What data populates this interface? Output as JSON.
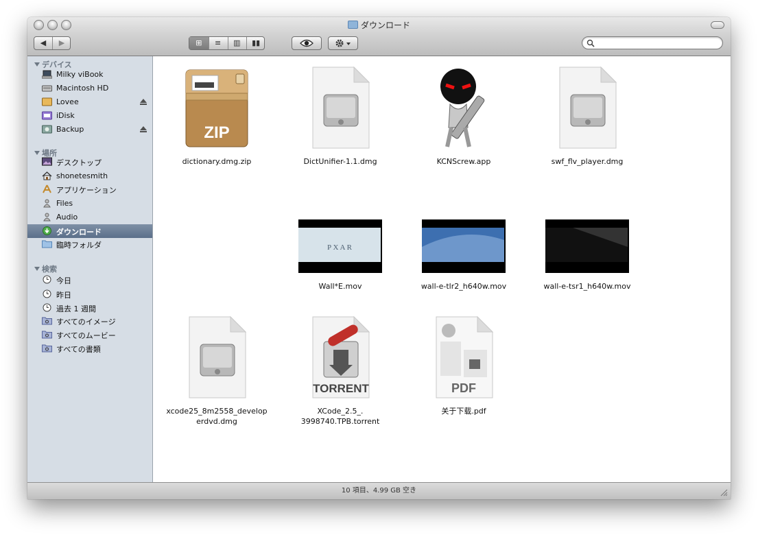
{
  "window": {
    "title": "ダウンロード"
  },
  "toolbar": {
    "back_label": "◀",
    "forward_label": "▶",
    "view_modes": [
      {
        "name": "icon-view",
        "glyph": "⊞",
        "selected": true
      },
      {
        "name": "list-view",
        "glyph": "≡",
        "selected": false
      },
      {
        "name": "column-view",
        "glyph": "▥",
        "selected": false
      },
      {
        "name": "coverflow-view",
        "glyph": "▮▮",
        "selected": false
      }
    ],
    "quicklook_glyph": "◉",
    "action_glyph": "✲▾",
    "search": {
      "placeholder": "",
      "icon": "magnifier-icon"
    }
  },
  "sidebar": {
    "sections": [
      {
        "heading": "デバイス",
        "items": [
          {
            "label": "Milky viBook",
            "icon": "laptop-icon",
            "eject": false
          },
          {
            "label": "Macintosh HD",
            "icon": "harddisk-icon",
            "eject": false
          },
          {
            "label": "Lovee",
            "icon": "external-disk-icon",
            "eject": true
          },
          {
            "label": "iDisk",
            "icon": "idisk-icon",
            "eject": false
          },
          {
            "label": "Backup",
            "icon": "backup-disk-icon",
            "eject": true
          }
        ]
      },
      {
        "heading": "場所",
        "items": [
          {
            "label": "デスクトップ",
            "icon": "desktop-icon"
          },
          {
            "label": "shonetesmith",
            "icon": "home-icon"
          },
          {
            "label": "アプリケーション",
            "icon": "applications-icon"
          },
          {
            "label": "Files",
            "icon": "person-icon"
          },
          {
            "label": "Audio",
            "icon": "person-icon"
          },
          {
            "label": "ダウンロード",
            "icon": "downloads-icon",
            "selected": true
          },
          {
            "label": "臨時フォルダ",
            "icon": "folder-icon"
          }
        ]
      },
      {
        "heading": "検索",
        "items": [
          {
            "label": "今日",
            "icon": "clock-icon"
          },
          {
            "label": "昨日",
            "icon": "clock-icon"
          },
          {
            "label": "過去 1 週間",
            "icon": "clock-icon"
          },
          {
            "label": "すべてのイメージ",
            "icon": "smart-folder-icon"
          },
          {
            "label": "すべてのムービー",
            "icon": "smart-folder-icon"
          },
          {
            "label": "すべての書類",
            "icon": "smart-folder-icon"
          }
        ]
      }
    ]
  },
  "files": [
    {
      "name": "dictionary.dmg.zip",
      "type": "zip",
      "badge": "ZIP"
    },
    {
      "name": "DictUnifier-1.1.dmg",
      "type": "dmg"
    },
    {
      "name": "KCNScrew.app",
      "type": "app"
    },
    {
      "name": "swf_flv_player.dmg",
      "type": "dmg"
    },
    {
      "name": "Wall*E.mov",
      "type": "movie",
      "badge": "P  X  A  R"
    },
    {
      "name": "wall-e-tlr2_h640w.mov",
      "type": "movie"
    },
    {
      "name": "wall-e-tsr1_h640w.mov",
      "type": "movie"
    },
    {
      "name": "xcode25_8m2558_develop\nerdvd.dmg",
      "type": "dmg"
    },
    {
      "name": "XCode_2.5_.\n3998740.TPB.torrent",
      "type": "torrent",
      "badge": "TORRENT"
    },
    {
      "name": "关于下载.pdf",
      "type": "pdf",
      "badge": "PDF"
    }
  ],
  "status": {
    "text": "10 項目、4.99 GB 空き"
  },
  "colors": {
    "sidebar_bg": "#d6dde5",
    "selection": "#5b6f8a",
    "zip_brown": "#b98a4f"
  }
}
